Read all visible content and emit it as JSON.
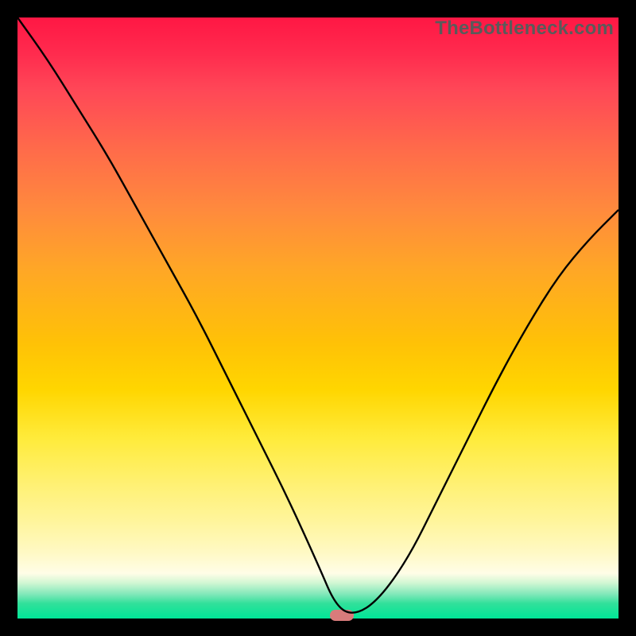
{
  "watermark": "TheBottleneck.com",
  "colors": {
    "background": "#000000",
    "curve": "#000000",
    "marker": "#d97b7b"
  },
  "chart_data": {
    "type": "line",
    "title": "",
    "xlabel": "",
    "ylabel": "",
    "xlim": [
      0,
      100
    ],
    "ylim": [
      0,
      100
    ],
    "grid": false,
    "annotations": [
      "TheBottleneck.com"
    ],
    "marker": {
      "x": 54,
      "y": 0.5,
      "w": 4,
      "h": 1.8
    },
    "series": [
      {
        "name": "bottleneck-curve",
        "x": [
          0,
          5,
          10,
          15,
          20,
          25,
          30,
          35,
          40,
          45,
          50,
          53,
          56,
          60,
          65,
          70,
          75,
          80,
          85,
          90,
          95,
          100
        ],
        "values": [
          100,
          93,
          85,
          77,
          68,
          59,
          50,
          40,
          30,
          20,
          9,
          2,
          0.5,
          3,
          10,
          20,
          30,
          40,
          49,
          57,
          63,
          68
        ]
      }
    ]
  }
}
